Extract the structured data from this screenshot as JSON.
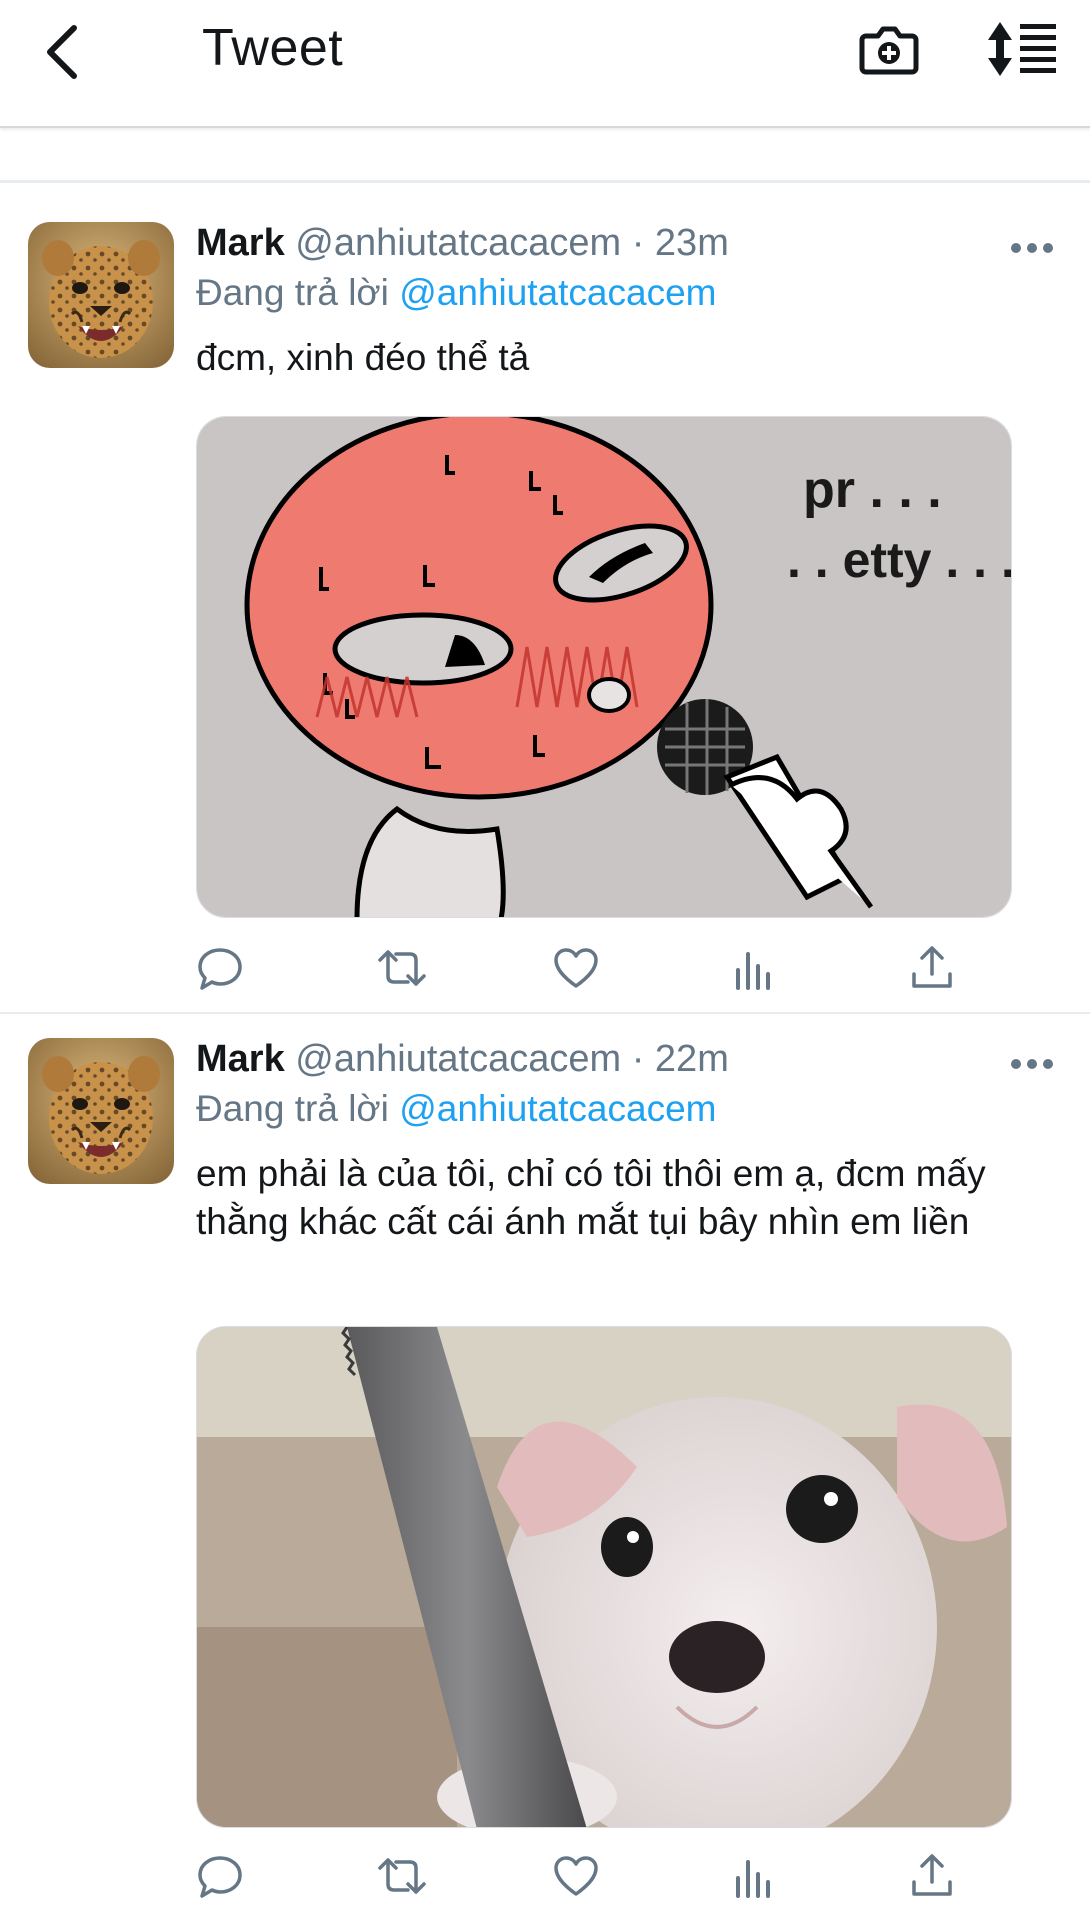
{
  "header": {
    "title": "Tweet",
    "back_icon": "chevron-left-icon",
    "camera_icon": "camera-plus-icon",
    "sort_icon": "sort-list-icon"
  },
  "colors": {
    "accent": "#1da1f2",
    "text": "#14171a",
    "secondary": "#657786",
    "divider": "#e6ecf0"
  },
  "tweets": [
    {
      "name": "Mark",
      "handle": "@anhiutatcacacem",
      "dot": "·",
      "time": "23m",
      "reply_prefix": "Đang trả lời",
      "reply_to": "@anhiutatcacacem",
      "text": "đcm, xinh đéo thể tả",
      "media_alt": "meme-red-face-microphone",
      "media_text_1": "pr . . .",
      "media_text_2": ". . etty . . ."
    },
    {
      "name": "Mark",
      "handle": "@anhiutatcacacem",
      "dot": "·",
      "time": "22m",
      "reply_prefix": "Đang trả lời",
      "reply_to": "@anhiutatcacacem",
      "text": "em phải là của tôi, chỉ có tôi thôi em ạ, đcm mấy thằng khác cất cái ánh mắt tụi bây nhìn em liền",
      "media_alt": "puppy-holding-knife"
    }
  ],
  "action_icons": [
    "reply-icon",
    "retweet-icon",
    "like-icon",
    "analytics-icon",
    "share-icon"
  ]
}
